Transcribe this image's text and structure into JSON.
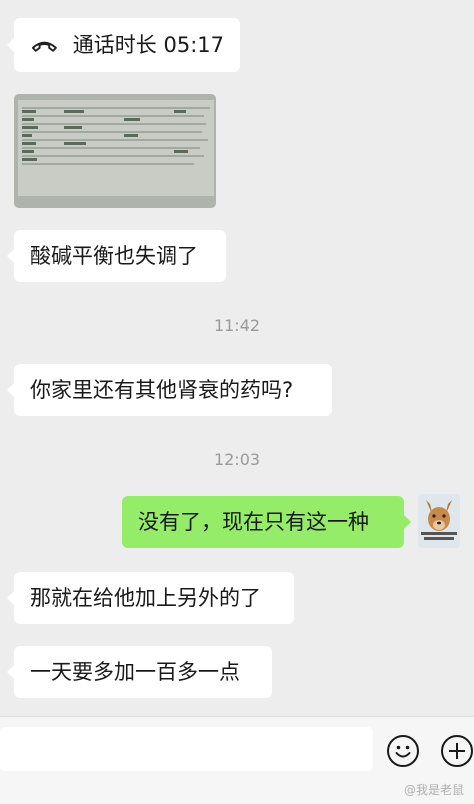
{
  "messages": {
    "call": "通话时长 05:17",
    "acid_base": "酸碱平衡也失调了",
    "time_1": "11:42",
    "other_meds": "你家里还有其他肾衰的药吗?",
    "time_2": "12:03",
    "reply": "没有了，现在只有这一种",
    "add_other": "那就在给他加上另外的了",
    "daily_more": "一天要多加一百多一点"
  },
  "watermark": "@我是老鼠",
  "icons": {
    "call": "phone-hangup-icon",
    "emoji": "emoji-icon",
    "plus": "plus-icon"
  },
  "colors": {
    "background": "#ededed",
    "incoming_bubble": "#ffffff",
    "outgoing_bubble": "#95ec69"
  }
}
